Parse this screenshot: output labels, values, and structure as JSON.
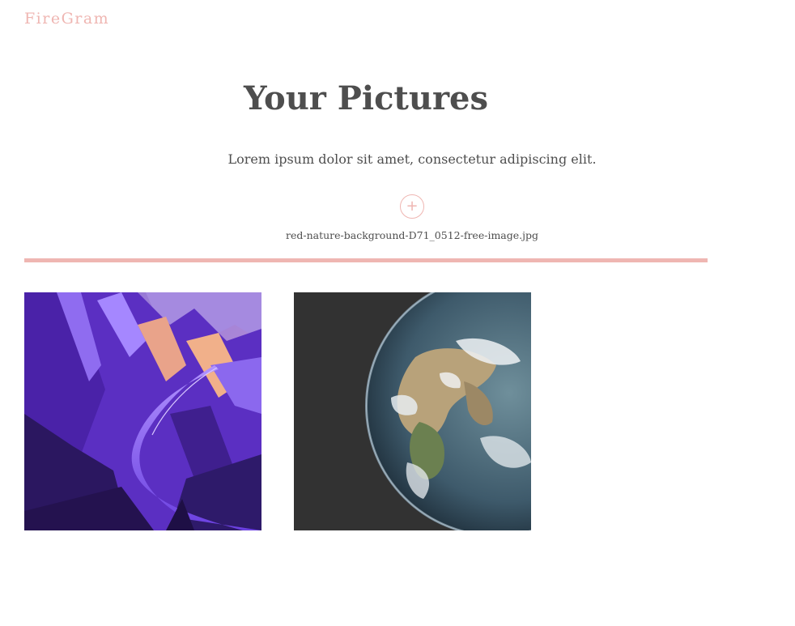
{
  "header": {
    "brand": "FireGram"
  },
  "main": {
    "title": "Your Pictures",
    "subtitle": "Lorem ipsum dolor sit amet, consectetur adipiscing elit.",
    "upload": {
      "icon": "plus-icon",
      "symbol": "+",
      "filename": "red-nature-background-D71_0512-free-image.jpg",
      "progress_percent": 100
    }
  },
  "gallery": {
    "images": [
      {
        "name": "purple-mountain-road-image"
      },
      {
        "name": "earth-globe-image"
      }
    ]
  },
  "colors": {
    "accent": "#efb6b2",
    "text": "#4e4e4e",
    "background": "#ffffff"
  }
}
